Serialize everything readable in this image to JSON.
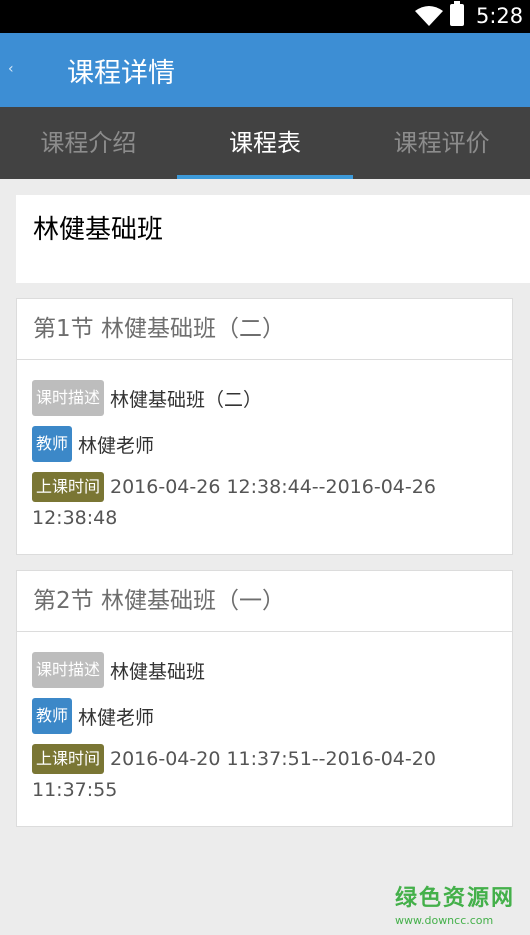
{
  "status_bar": {
    "time": "5:28"
  },
  "app_bar": {
    "title": "课程详情"
  },
  "tabs": [
    {
      "label": "课程介绍",
      "active": false
    },
    {
      "label": "课程表",
      "active": true
    },
    {
      "label": "课程评价",
      "active": false
    }
  ],
  "course": {
    "name": "林健基础班"
  },
  "lessons": [
    {
      "header": "第1节 林健基础班（二）",
      "desc_tag": "课时描述",
      "desc": "林健基础班（二）",
      "teacher_tag": "教师",
      "teacher": "林健老师",
      "time_tag": "上课时间",
      "time_start": "2016-04-26 12:38:44--2016-04-26",
      "time_end": "12:38:48"
    },
    {
      "header": "第2节 林健基础班（一）",
      "desc_tag": "课时描述",
      "desc": "林健基础班",
      "teacher_tag": "教师",
      "teacher": "林健老师",
      "time_tag": "上课时间",
      "time_start": "2016-04-20 11:37:51--2016-04-20",
      "time_end": "11:37:55"
    }
  ],
  "watermark": {
    "title": "绿色资源网",
    "url": "www.downcc.com"
  }
}
